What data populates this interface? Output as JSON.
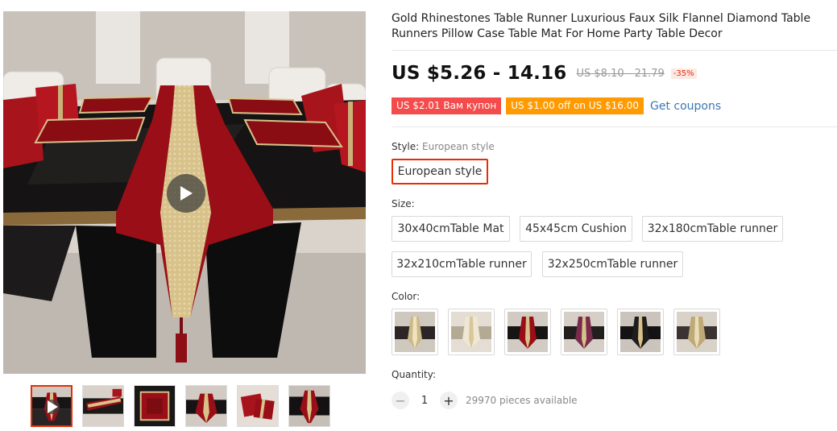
{
  "gallery": {
    "main_image_desc": "table runner on dining table",
    "thumbnails": [
      {
        "variant": "red-video",
        "active": true,
        "has_video": true
      },
      {
        "variant": "red-wide",
        "active": false
      },
      {
        "variant": "red-mat",
        "active": false
      },
      {
        "variant": "red-room",
        "active": false
      },
      {
        "variant": "red-pillow",
        "active": false
      },
      {
        "variant": "red-dark",
        "active": false
      }
    ]
  },
  "product": {
    "title": "Gold Rhinestones Table Runner Luxurious Faux Silk Flannel Diamond Table Runners Pillow Case Table Mat For Home Party Table Decor",
    "price": "US $5.26 - 14.16",
    "original_price": "US $8.10 - 21.79",
    "discount": "-35%"
  },
  "coupons": {
    "coupon_1": "US $2.01 Вам купон",
    "coupon_2": "US $1.00 off on US $16.00",
    "get_coupons": "Get coupons"
  },
  "style": {
    "label": "Style:",
    "selected_value": "European style",
    "options": [
      "European style"
    ]
  },
  "size": {
    "label": "Size:",
    "options": [
      "30x40cmTable Mat",
      "45x45cm Cushion",
      "32x180cmTable runner",
      "32x210cmTable runner",
      "32x250cmTable runner"
    ]
  },
  "color": {
    "label": "Color:",
    "swatches": [
      "gold-runner",
      "cream-runner",
      "red-runner",
      "rose-runner",
      "black-gold-runner",
      "champagne-runner"
    ]
  },
  "quantity": {
    "label": "Quantity:",
    "minus_icon": "−",
    "plus_icon": "+",
    "value": "1",
    "available": "29970 pieces available"
  },
  "colors": {
    "accent": "#e62e04",
    "coupon_red": "#f44c4c",
    "coupon_orange": "#ff9a00",
    "link_blue": "#3a77b8"
  }
}
